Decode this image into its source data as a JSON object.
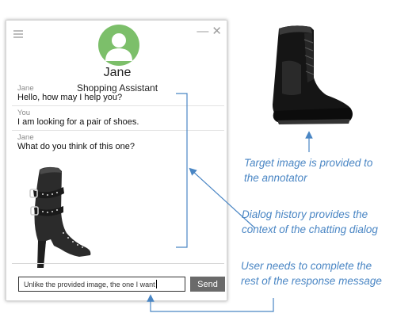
{
  "chat": {
    "agent_name": "Jane",
    "agent_role": "Shopping Assistant",
    "messages": [
      {
        "sender": "Jane",
        "text": "Hello, how may I help you?"
      },
      {
        "sender": "You",
        "text": "I am looking for a pair of shoes."
      },
      {
        "sender": "Jane",
        "text": "What do you think of this one?"
      }
    ],
    "input_value": "Unlike the provided image, the one I want",
    "send_label": "Send"
  },
  "window_controls": {
    "minimize": "—",
    "close": "✕"
  },
  "annotations": {
    "target": [
      "Target image is provided to",
      "the annotator"
    ],
    "dialog": [
      "Dialog history provides the",
      "context of the chatting dialog"
    ],
    "user": [
      "User needs to complete the",
      "rest of the response message"
    ]
  },
  "colors": {
    "annotation": "#4a86c4",
    "avatar": "#7cbf6a",
    "send_button": "#6a6a6a"
  }
}
